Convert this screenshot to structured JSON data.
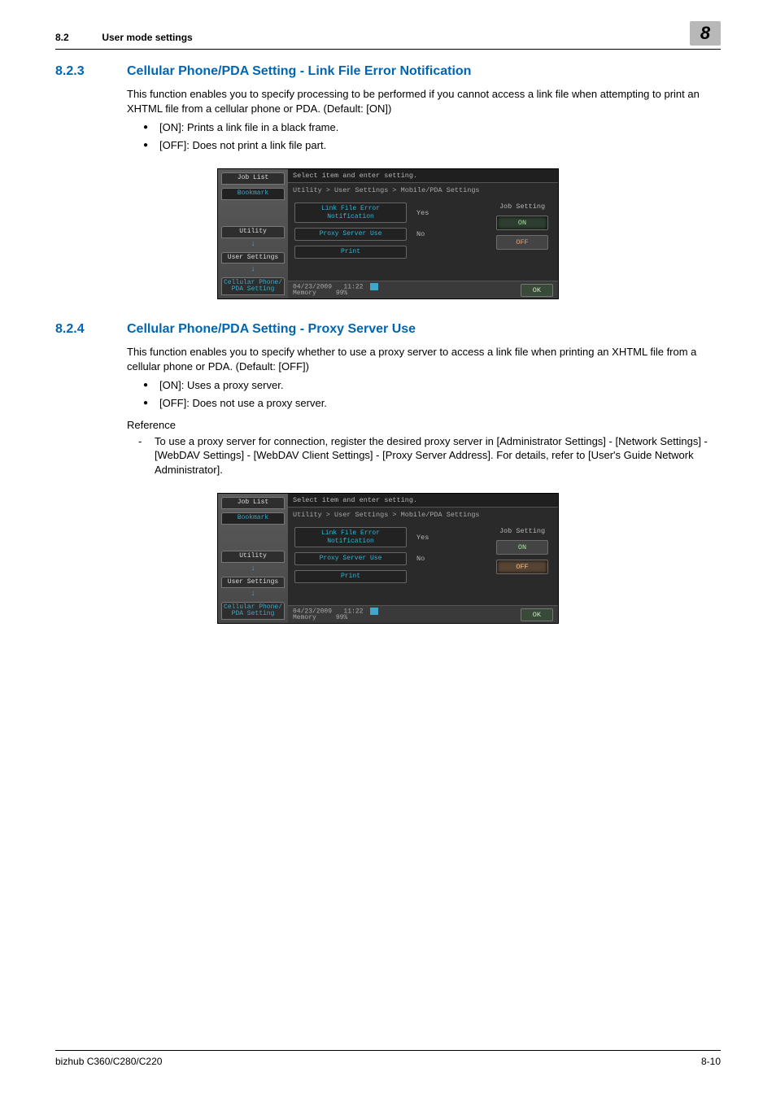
{
  "header": {
    "section_number": "8.2",
    "section_title": "User mode settings",
    "chapter_number": "8"
  },
  "sec823": {
    "num": "8.2.3",
    "title": "Cellular Phone/PDA Setting - Link File Error Notification",
    "intro": "This function enables you to specify processing to be performed if you cannot access a link file when attempting to print an XHTML file from a cellular phone or PDA. (Default: [ON])",
    "bullets": [
      "[ON]: Prints a link file in a black frame.",
      "[OFF]: Does not print a link file part."
    ]
  },
  "sec824": {
    "num": "8.2.4",
    "title": "Cellular Phone/PDA Setting - Proxy Server Use",
    "intro": "This function enables you to specify whether to use a proxy server to access a link file when printing an XHTML file from a cellular phone or PDA. (Default: [OFF])",
    "bullets": [
      "[ON]: Uses a proxy server.",
      "[OFF]: Does not use a proxy server."
    ],
    "reference_label": "Reference",
    "reference_items": [
      "To use a proxy server for connection, register the desired proxy server in [Administrator Settings] - [Network Settings] - [WebDAV Settings] - [WebDAV Client Settings] - [Proxy Server Address]. For details, refer to [User's Guide Network Administrator]."
    ]
  },
  "ui": {
    "top_text": "Select item and enter setting.",
    "path": "Utility > User Settings > Mobile/PDA Settings",
    "left_tabs": {
      "job_list": "Job List",
      "bookmark": "Bookmark",
      "utility": "Utility",
      "user_settings": "User Settings",
      "cell_pda": "Cellular Phone/\nPDA Setting"
    },
    "rows": {
      "r1_label": "Link File Error Notification",
      "r1_val": "Yes",
      "r2_label": "Proxy Server Use",
      "r2_val": "No",
      "r3_label": "Print"
    },
    "right": {
      "job_setting": "Job Setting",
      "on": "ON",
      "off": "OFF"
    },
    "bottom": {
      "date": "04/23/2009",
      "time": "11:22",
      "mem_label": "Memory",
      "mem_val": "99%",
      "ok": "OK"
    }
  },
  "footer": {
    "left": "bizhub C360/C280/C220",
    "right": "8-10"
  }
}
